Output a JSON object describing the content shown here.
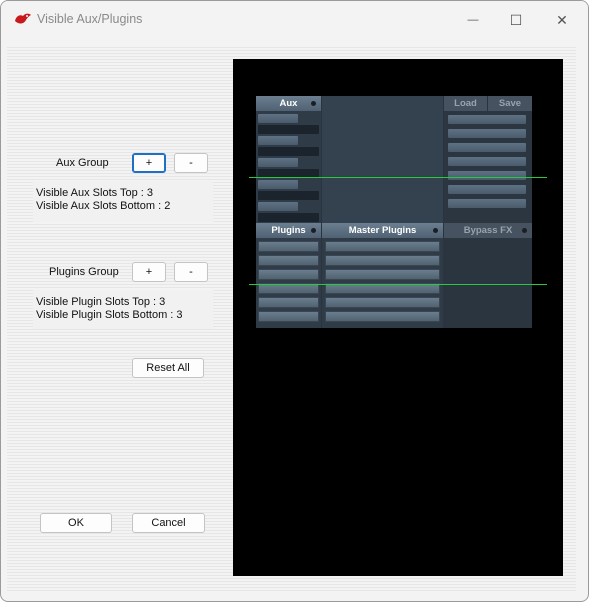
{
  "window": {
    "title": "Visible Aux/Plugins",
    "minimize_glyph": "—",
    "maximize_glyph": "☐",
    "close_glyph": "✕"
  },
  "aux_group": {
    "label": "Aux Group",
    "plus_label": "+",
    "minus_label": "-",
    "info_top": "Visible Aux Slots Top : 3",
    "info_bottom": "Visible Aux Slots Bottom : 2"
  },
  "plugins_group": {
    "label": "Plugins Group",
    "plus_label": "+",
    "minus_label": "-",
    "info_top": "Visible Plugin Slots Top : 3",
    "info_bottom": "Visible Plugin Slots Bottom : 3"
  },
  "reset_label": "Reset All",
  "ok_label": "OK",
  "cancel_label": "Cancel",
  "preview": {
    "aux_header": "Aux",
    "load_label": "Load",
    "save_label": "Save",
    "plugins_header": "Plugins",
    "master_plugins_header": "Master Plugins",
    "bypass_header": "Bypass FX"
  },
  "colors": {
    "accent": "#1f6fc4",
    "guide_line": "#27c93f",
    "preview_bg": "#000000",
    "mixer_bg": "#2a3440"
  },
  "icons": {
    "app": "red-bird-icon"
  }
}
